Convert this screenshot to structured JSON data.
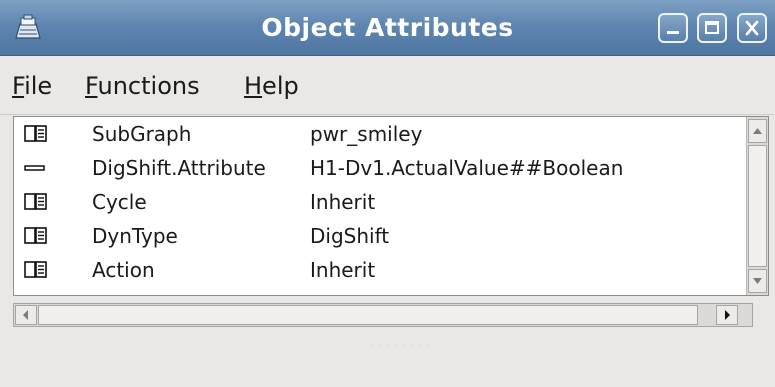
{
  "window": {
    "title": "Object Attributes"
  },
  "icons": {
    "app": "app-icon",
    "minimize": "minimize-icon",
    "maximize": "maximize-icon",
    "close": "close-icon",
    "folder": "folder-icon",
    "attribute": "dash-icon"
  },
  "menu": {
    "file": {
      "mnemonic": "F",
      "rest": "ile"
    },
    "functions": {
      "mnemonic": "F",
      "rest": "unctions"
    },
    "help": {
      "pre": "",
      "mnemonic": "H",
      "rest": "elp"
    }
  },
  "attributes": [
    {
      "icon": "folder-icon",
      "name": "SubGraph",
      "value": "pwr_smiley"
    },
    {
      "icon": "dash-icon",
      "name": "DigShift.Attribute",
      "value": "H1-Dv1.ActualValue##Boolean"
    },
    {
      "icon": "folder-icon",
      "name": "Cycle",
      "value": "Inherit"
    },
    {
      "icon": "folder-icon",
      "name": "DynType",
      "value": "DigShift"
    },
    {
      "icon": "folder-icon",
      "name": "Action",
      "value": "Inherit"
    }
  ],
  "colors": {
    "titlebar": "#5f86b0",
    "background": "#e9e8e6",
    "list_background": "#ffffff"
  }
}
